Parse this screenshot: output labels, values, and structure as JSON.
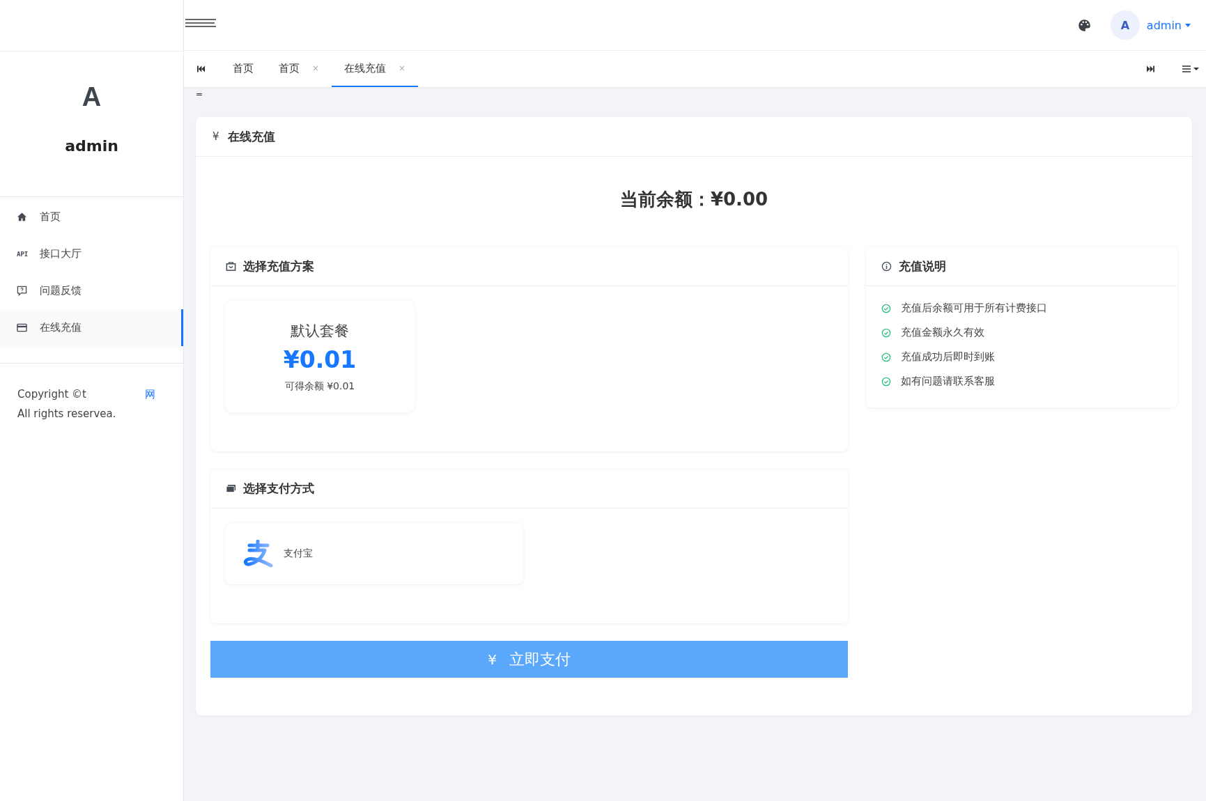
{
  "header": {
    "user": {
      "avatar_letter": "A",
      "name": "admin"
    }
  },
  "tabs": [
    {
      "label": "首页",
      "closable": false,
      "selected": false
    },
    {
      "label": "首页",
      "closable": true,
      "selected": false
    },
    {
      "label": "在线充值",
      "closable": true,
      "selected": true
    }
  ],
  "tab_close": "×",
  "collapse_mark": "=",
  "sidebar": {
    "avatar_letter": "A",
    "username": "admin",
    "items": [
      {
        "label": "首页",
        "kind": "home",
        "selected": false
      },
      {
        "label": "接口大厅",
        "kind": "api",
        "icon_text": "API",
        "selected": false
      },
      {
        "label": "问题反馈",
        "kind": "feedback",
        "selected": false
      },
      {
        "label": "在线充值",
        "kind": "card",
        "selected": true
      }
    ],
    "footer": {
      "copyright": "Copyright ©t",
      "link": "网",
      "rights": "All rights reservea."
    }
  },
  "page": {
    "title_icon": "¥",
    "title": "在线充值",
    "balance": "当前余额：¥0.00",
    "plans": {
      "title": "选择充值方案",
      "items": [
        {
          "name": "默认套餐",
          "price": "¥0.01",
          "gets": "可得余额 ¥0.01"
        }
      ]
    },
    "notes": {
      "title": "充值说明",
      "items": [
        "充值后余额可用于所有计费接口",
        "充值金额永久有效",
        "充值成功后即时到账",
        "如有问题请联系客服"
      ]
    },
    "payment": {
      "title": "选择支付方式",
      "methods": [
        {
          "name": "支付宝",
          "kind": "alipay"
        }
      ]
    },
    "pay_button": {
      "icon": "¥",
      "label": "立即支付"
    }
  }
}
